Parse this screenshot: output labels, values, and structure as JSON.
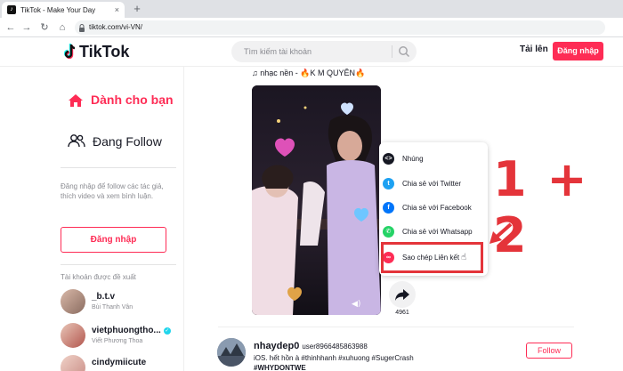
{
  "browser": {
    "tab_title": "TikTok - Make Your Day",
    "tab_close": "×",
    "new_tab": "+",
    "url": "tiktok.com/vi-VN/"
  },
  "header": {
    "logo_text": "TikTok",
    "search_placeholder": "Tìm kiếm tài khoản",
    "upload_label": "Tải lên",
    "login_label": "Đăng nhập"
  },
  "sidebar": {
    "for_you_label": "Dành cho bạn",
    "following_label": "Đang Follow",
    "login_hint": "Đăng nhập để follow các tác giả, thích video và xem bình luận.",
    "login_button": "Đăng nhập",
    "suggested_heading": "Tài khoản được đề xuất",
    "accounts": [
      {
        "username": "_b.t.v",
        "nickname": "Bùi Thanh Vân",
        "verified": false
      },
      {
        "username": "vietphuongtho...",
        "nickname": "Viết Phương Thoa",
        "verified": true
      },
      {
        "username": "cindymiicute",
        "nickname": "",
        "verified": false
      }
    ]
  },
  "post": {
    "music": "♫ nhạc nền - 🔥K M QUYÊN🔥",
    "share_count": "4961"
  },
  "share_menu": {
    "items": [
      {
        "label": "Nhúng",
        "icon": "embed-icon",
        "color": "#161823"
      },
      {
        "label": "Chia sẻ với Twitter",
        "icon": "twitter-icon",
        "color": "#1da1f2"
      },
      {
        "label": "Chia sẻ với Facebook",
        "icon": "facebook-icon",
        "color": "#0075fa"
      },
      {
        "label": "Chia sẻ với Whatsapp",
        "icon": "whatsapp-icon",
        "color": "#25d366"
      },
      {
        "label": "Sao chép Liên kết",
        "icon": "link-icon",
        "color": "#fe2c55"
      }
    ]
  },
  "annotation": {
    "text": "1 + 2",
    "color": "#e4343a"
  },
  "next_post": {
    "username": "nhaydep0",
    "user_id": "user8966485863988",
    "caption": "iOS. hết hồn à #thinhhanh #xuhuong #SugerCrash",
    "caption_line2": "#WHYDONTWE",
    "follow_label": "Follow"
  },
  "colors": {
    "brand": "#fe2c55",
    "annotation_red": "#e4343a"
  }
}
